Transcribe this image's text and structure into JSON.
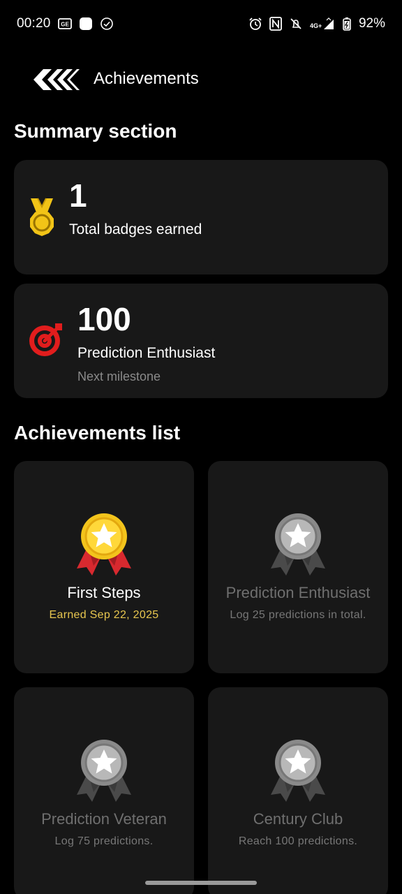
{
  "status_bar": {
    "time": "00:20",
    "battery": "92%",
    "network": "4G+"
  },
  "header": {
    "title": "Achievements"
  },
  "summary": {
    "heading": "Summary section",
    "badges": {
      "value": "1",
      "label": "Total badges earned",
      "icon": "gold-medal-icon"
    },
    "milestone": {
      "value": "100",
      "label": "Prediction Enthusiast",
      "sub": "Next milestone",
      "icon": "target-icon"
    }
  },
  "achievements": {
    "heading": "Achievements list",
    "items": [
      {
        "title": "First Steps",
        "sub": "Earned Sep 22, 2025",
        "earned": true
      },
      {
        "title": "Prediction Enthusiast",
        "sub": "Log 25 predictions in total.",
        "earned": false
      },
      {
        "title": "Prediction Veteran",
        "sub": "Log 75 predictions.",
        "earned": false
      },
      {
        "title": "Century Club",
        "sub": "Reach 100 predictions.",
        "earned": false
      }
    ]
  },
  "colors": {
    "background": "#000000",
    "card": "#181818",
    "earned_accent": "#e7c64f",
    "muted": "#777777",
    "target_red": "#e11d1d",
    "gold": "#f2c417"
  }
}
